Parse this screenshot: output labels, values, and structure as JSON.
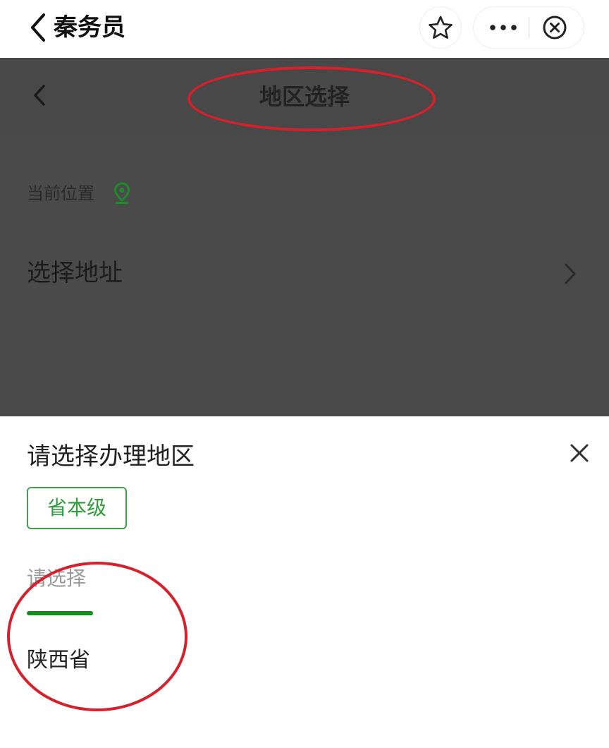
{
  "topbar": {
    "title": "秦务员",
    "icons": [
      "chevron-left-icon",
      "star-icon",
      "more-icon",
      "close-circle-icon"
    ]
  },
  "page_header": {
    "title": "地区选择",
    "back_icon": "chevron-left-icon"
  },
  "location": {
    "label": "当前位置",
    "icon": "location-pin-icon",
    "icon_color": "#1e8a2b",
    "address_placeholder": "选择地址"
  },
  "sheet": {
    "title": "请选择办理地区",
    "selected_level": "省本级",
    "tab_placeholder": "请选择",
    "options": [
      "陕西省"
    ],
    "accent_color": "#17891d"
  },
  "colors": {
    "annotation": "#d6202b",
    "overlay": "#4a4a4a"
  }
}
